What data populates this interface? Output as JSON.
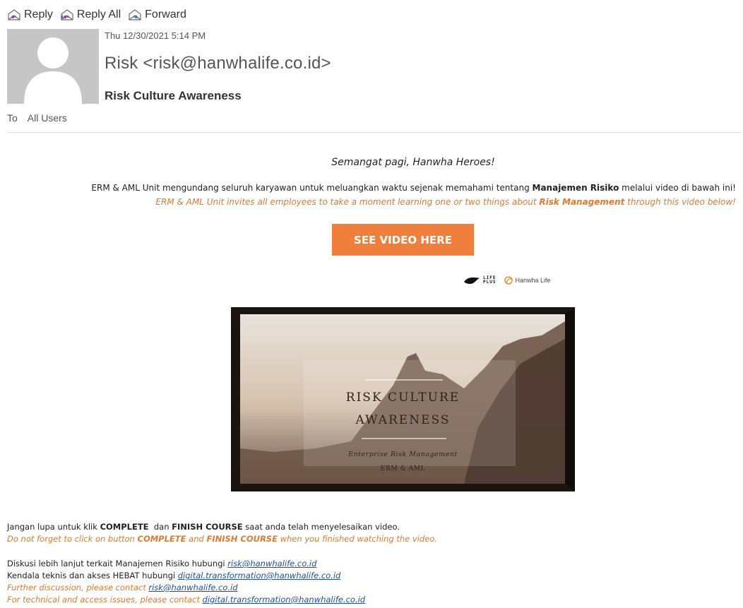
{
  "toolbar": {
    "reply": "Reply",
    "reply_all": "Reply All",
    "forward": "Forward"
  },
  "header": {
    "date": "Thu 12/30/2021 5:14 PM",
    "sender": "Risk <risk@hanwhalife.co.id>",
    "subject": "Risk Culture Awareness",
    "to_label": "To",
    "to_value": "All Users"
  },
  "body": {
    "greeting": "Semangat pagi, Hanwha Heroes!",
    "intro_id_pre": "ERM & AML Unit mengundang seluruh karyawan untuk meluangkan waktu sejenak memahami tentang ",
    "intro_id_bold": "Manajemen Risiko",
    "intro_id_post": " melalui video di bawah ini!",
    "intro_en_pre": "ERM & AML Unit invites all employees to take a moment learning one or two things about ",
    "intro_en_bold": "Risk Management",
    "intro_en_post": " through this video below!",
    "cta_label": "SEE VIDEO HERE",
    "logo_lifeplus_line1": "LIFE",
    "logo_lifeplus_line2": "PLUS",
    "logo_hanwha": "Hanwha Life",
    "banner_title_1": "RISK CULTURE",
    "banner_title_2": "AWARENESS",
    "banner_subtitle": "Enterprise Risk Management",
    "banner_unit": "ERM & AML",
    "reminder_id_1": "Jangan lupa untuk klik ",
    "reminder_id_complete": "COMPLETE",
    "reminder_id_2": "  dan ",
    "reminder_id_finish": "FINISH COURSE",
    "reminder_id_3": " saat anda telah menyelesaikan video.",
    "reminder_en_1": "Do not forget to click on button ",
    "reminder_en_complete": "COMPLETE",
    "reminder_en_2": " and ",
    "reminder_en_finish": "FINISH COURSE",
    "reminder_en_3": " when you finished watching the video.",
    "contact_id_1": "Diskusi lebih lanjut terkait Manajemen Risiko hubungi ",
    "contact_id_2": "Kendala teknis dan akses HEBAT hubungi ",
    "contact_en_1": "Further discussion, please contact ",
    "contact_en_2": "For technical and access issues, please contact ",
    "email_risk": "risk@hanwhalife.co.id",
    "email_digital": "digital.transformation@hanwhalife.co.id"
  },
  "colors": {
    "accent_orange": "#ef7f3a",
    "link_blue": "#1f4fa8",
    "avatar_gray": "#c6c6c6"
  }
}
